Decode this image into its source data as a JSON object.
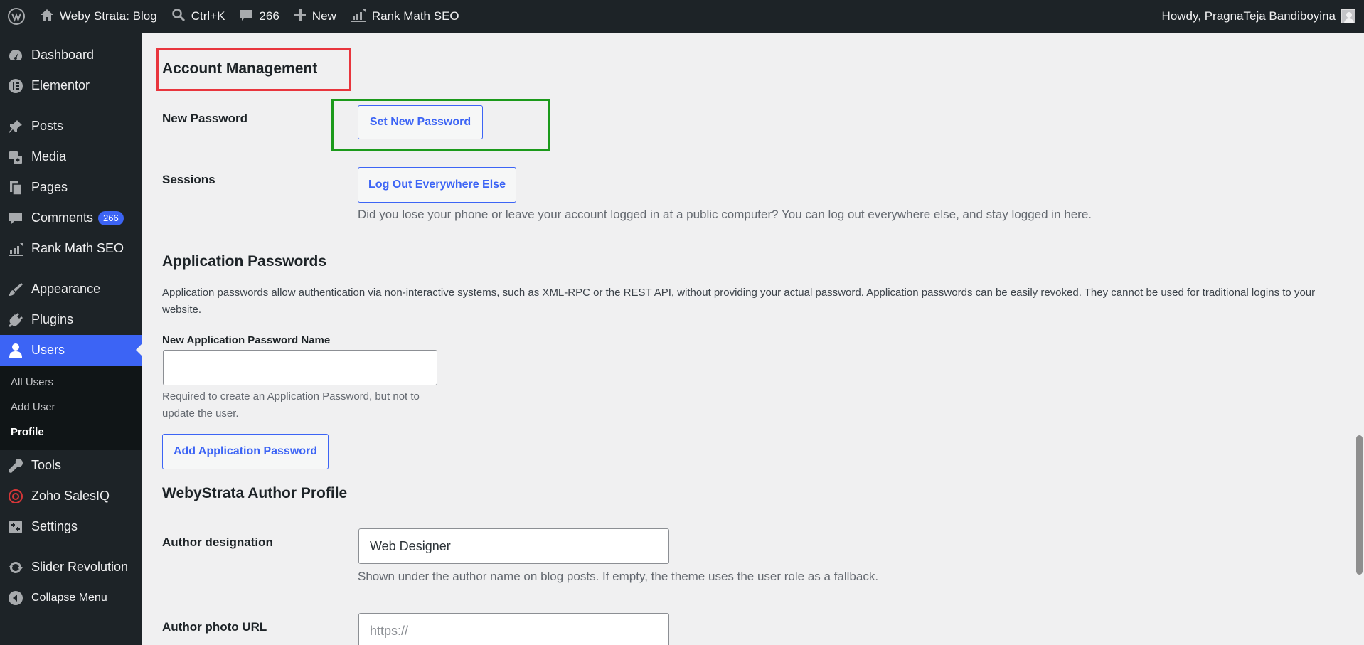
{
  "adminbar": {
    "site_name": "Weby Strata: Blog",
    "search_shortcut": "Ctrl+K",
    "comments_count": "266",
    "new_label": "New",
    "rankmath_label": "Rank Math SEO",
    "howdy": "Howdy, PragnaTeja Bandiboyina"
  },
  "sidebar": {
    "items": [
      {
        "label": "Dashboard",
        "icon": "dashboard-icon"
      },
      {
        "label": "Elementor",
        "icon": "elementor-icon"
      },
      {
        "label": "Posts",
        "icon": "pin-icon"
      },
      {
        "label": "Media",
        "icon": "media-icon"
      },
      {
        "label": "Pages",
        "icon": "pages-icon"
      },
      {
        "label": "Comments",
        "icon": "comment-icon",
        "badge": "266"
      },
      {
        "label": "Rank Math SEO",
        "icon": "rankmath-icon"
      },
      {
        "label": "Appearance",
        "icon": "brush-icon"
      },
      {
        "label": "Plugins",
        "icon": "plug-icon"
      },
      {
        "label": "Users",
        "icon": "user-icon"
      },
      {
        "label": "Tools",
        "icon": "wrench-icon"
      },
      {
        "label": "Zoho SalesIQ",
        "icon": "zoho-icon"
      },
      {
        "label": "Settings",
        "icon": "settings-icon"
      },
      {
        "label": "Slider Revolution",
        "icon": "refresh-icon"
      },
      {
        "label": "Collapse Menu",
        "icon": "collapse-icon"
      }
    ],
    "users_submenu": [
      "All Users",
      "Add User",
      "Profile"
    ]
  },
  "main": {
    "account_title": "Account Management",
    "new_password_label": "New Password",
    "set_password_button": "Set New Password",
    "sessions_label": "Sessions",
    "logout_button": "Log Out Everywhere Else",
    "sessions_desc": "Did you lose your phone or leave your account logged in at a public computer? You can log out everywhere else, and stay logged in here.",
    "app_pw_title": "Application Passwords",
    "app_pw_desc": "Application passwords allow authentication via non-interactive systems, such as XML-RPC or the REST API, without providing your actual password. Application passwords can be easily revoked. They cannot be used for traditional logins to your website.",
    "app_pw_name_label": "New Application Password Name",
    "app_pw_name_value": "",
    "app_pw_hint": "Required to create an Application Password, but not to update the user.",
    "add_app_pw_button": "Add Application Password",
    "author_profile_title": "WebyStrata Author Profile",
    "author_designation_label": "Author designation",
    "author_designation_value": "Web Designer",
    "author_designation_desc": "Shown under the author name on blog posts. If empty, the theme uses the user role as a fallback.",
    "author_photo_label": "Author photo URL",
    "author_photo_placeholder": "https://"
  },
  "colors": {
    "accent": "#3c64f5",
    "annotation_red": "#e8353d",
    "annotation_green": "#1b9a1b"
  }
}
